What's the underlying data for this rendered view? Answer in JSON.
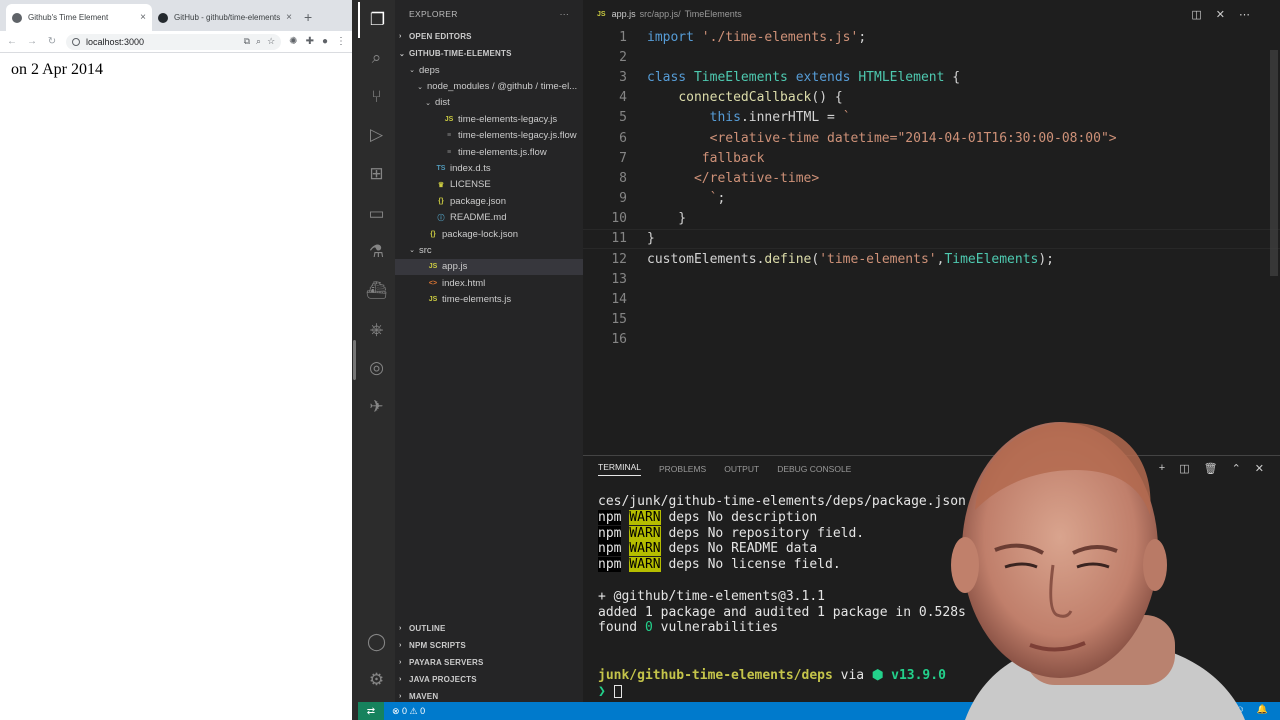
{
  "browser": {
    "tabs": [
      {
        "title": "Github's Time Element",
        "close": "×"
      },
      {
        "title": "GitHub - github/time-elements",
        "close": "×"
      }
    ],
    "new_tab": "+",
    "url": "localhost:3000",
    "page_text": "on 2 Apr 2014"
  },
  "sidebar": {
    "title": "EXPLORER",
    "more": "···",
    "open_editors": "OPEN EDITORS",
    "project": "GITHUB-TIME-ELEMENTS",
    "tree": [
      {
        "label": "deps",
        "indent": 1,
        "chev": "⌄",
        "icon": ""
      },
      {
        "label": "node_modules / @github / time-el...",
        "indent": 2,
        "chev": "⌄",
        "icon": ""
      },
      {
        "label": "dist",
        "indent": 3,
        "chev": "⌄",
        "icon": ""
      },
      {
        "label": "time-elements-legacy.js",
        "indent": 4,
        "chev": "",
        "icon": "js"
      },
      {
        "label": "time-elements-legacy.js.flow",
        "indent": 4,
        "chev": "",
        "icon": "flow"
      },
      {
        "label": "time-elements.js.flow",
        "indent": 4,
        "chev": "",
        "icon": "flow"
      },
      {
        "label": "index.d.ts",
        "indent": 3,
        "chev": "",
        "icon": "ts"
      },
      {
        "label": "LICENSE",
        "indent": 3,
        "chev": "",
        "icon": "lic"
      },
      {
        "label": "package.json",
        "indent": 3,
        "chev": "",
        "icon": "json"
      },
      {
        "label": "README.md",
        "indent": 3,
        "chev": "",
        "icon": "md"
      },
      {
        "label": "package-lock.json",
        "indent": 2,
        "chev": "",
        "icon": "json"
      },
      {
        "label": "src",
        "indent": 1,
        "chev": "⌄",
        "icon": ""
      },
      {
        "label": "app.js",
        "indent": 2,
        "chev": "",
        "icon": "js",
        "selected": true
      },
      {
        "label": "index.html",
        "indent": 2,
        "chev": "",
        "icon": "html"
      },
      {
        "label": "time-elements.js",
        "indent": 2,
        "chev": "",
        "icon": "js"
      }
    ],
    "bottom_sections": [
      "OUTLINE",
      "NPM SCRIPTS",
      "PAYARA SERVERS",
      "JAVA PROJECTS",
      "MAVEN"
    ]
  },
  "editor": {
    "tab_file": "app.js",
    "breadcrumb_path": "src/app.js/",
    "breadcrumb_symbol": "TimeElements",
    "line_numbers": [
      "1",
      "2",
      "3",
      "4",
      "5",
      "6",
      "7",
      "8",
      "9",
      "10",
      "11",
      "12",
      "13",
      "14",
      "15",
      "16"
    ]
  },
  "panel": {
    "tabs": [
      "TERMINAL",
      "PROBLEMS",
      "OUTPUT",
      "DEBUG CONSOLE"
    ],
    "line1": "ces/junk/github-time-elements/deps/package.json",
    "warn_lines": [
      "deps No description",
      "deps No repository field.",
      "deps No README data",
      "deps No license field."
    ],
    "npm": "npm",
    "warn": "WARN",
    "added_pkg": "+ @github/time-elements@3.1.1",
    "audited": "added 1 package and audited 1 package in 0.528s",
    "found_pre": "found ",
    "found_zero": "0",
    "found_post": " vulnerabilities",
    "prompt_path": "junk/github-time-elements/deps",
    "prompt_via": " via ",
    "node_version": "⬢ v13.9.0",
    "prompt_char": "❯"
  },
  "status": {
    "remote_icon": "⇄",
    "problems": "⊗ 0 ⚠ 0"
  },
  "colors": {
    "accent": "#007acc",
    "remote": "#16825d"
  }
}
